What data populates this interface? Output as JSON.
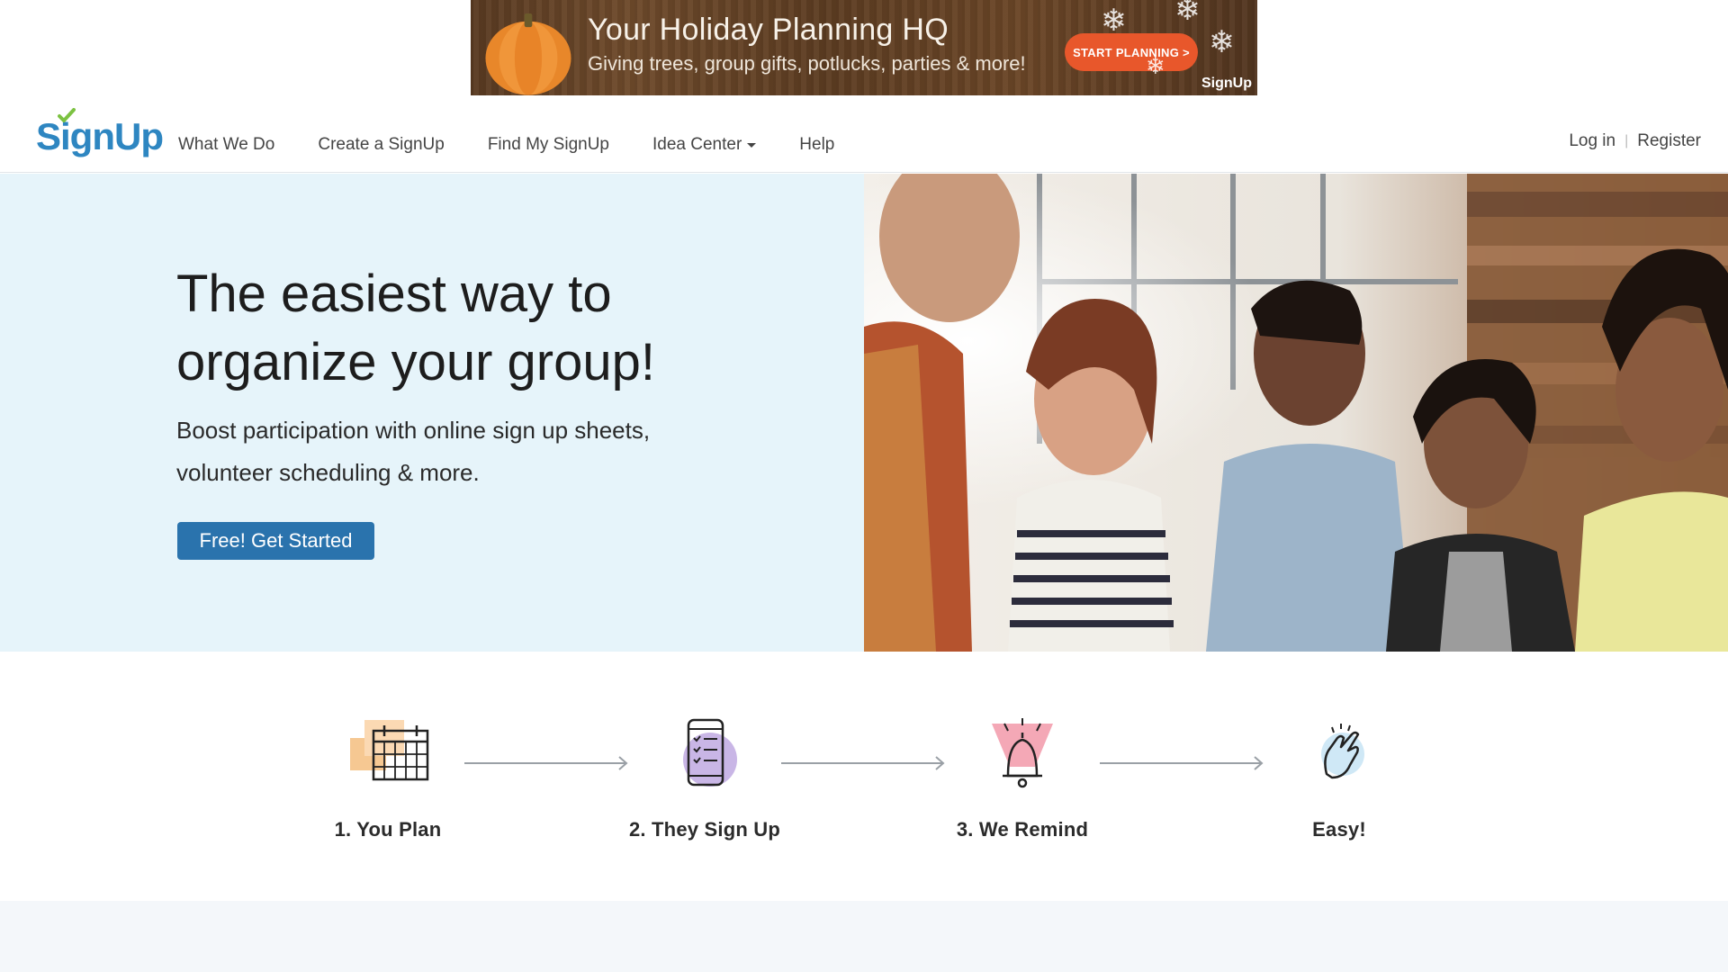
{
  "ad": {
    "title": "Your Holiday Planning HQ",
    "subtitle": "Giving trees, group gifts, potlucks, parties & more!",
    "cta": "START PLANNING >",
    "logo": "SignUp"
  },
  "nav": {
    "logo": "SignUp",
    "links": [
      "What We Do",
      "Create a SignUp",
      "Find My SignUp",
      "Idea Center",
      "Help"
    ],
    "login": "Log in",
    "separator": "|",
    "register": "Register"
  },
  "hero": {
    "title": "The easiest way to organize your group!",
    "subtitle": "Boost participation with online sign up sheets, volunteer scheduling & more.",
    "cta": "Free! Get Started"
  },
  "steps": [
    {
      "label": "1. You Plan",
      "icon": "calendar-icon"
    },
    {
      "label": "2. They Sign Up",
      "icon": "phone-checklist-icon"
    },
    {
      "label": "3. We Remind",
      "icon": "bell-icon"
    },
    {
      "label": "Easy!",
      "icon": "finger-snap-icon"
    }
  ],
  "colors": {
    "brand_blue": "#2e86c1",
    "cta_blue": "#2a73ad",
    "hero_bg": "#e6f4fa",
    "ad_cta": "#e8572b"
  }
}
